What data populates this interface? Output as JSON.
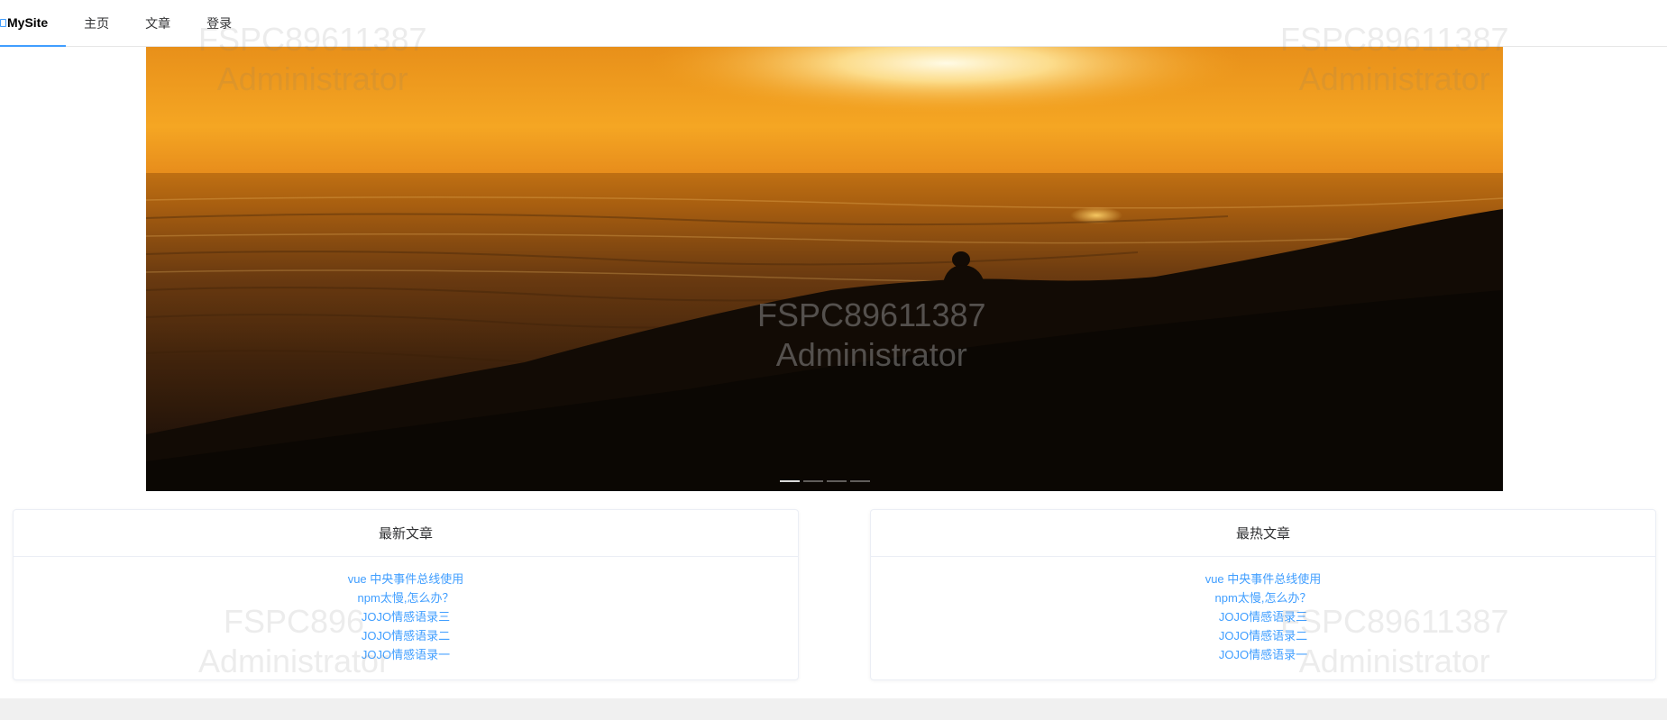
{
  "nav": {
    "brand": "MySite",
    "items": [
      {
        "label": "主页"
      },
      {
        "label": "文章"
      },
      {
        "label": "登录"
      }
    ]
  },
  "carousel": {
    "indicator_count": 4,
    "active_index": 0
  },
  "latest": {
    "title": "最新文章",
    "articles": [
      "vue 中央事件总线使用",
      "npm太慢,怎么办？",
      "JOJO情感语录三",
      "JOJO情感语录二",
      "JOJO情感语录一"
    ]
  },
  "hottest": {
    "title": "最热文章",
    "articles": [
      "vue 中央事件总线使用",
      "npm太慢,怎么办？",
      "JOJO情感语录三",
      "JOJO情感语录二",
      "JOJO情感语录一"
    ]
  },
  "watermark": {
    "line1": "FSPC89611387",
    "line2": "Administrator",
    "line1_partial": "FSPC896"
  },
  "colors": {
    "accent": "#409eff",
    "link": "#409eff"
  }
}
